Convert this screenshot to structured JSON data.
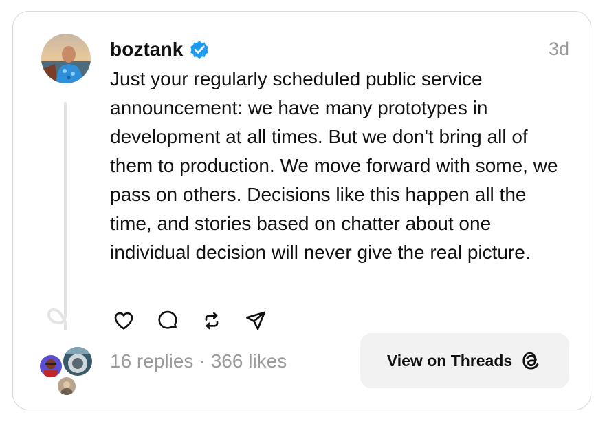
{
  "post": {
    "username": "boztank",
    "timestamp": "3d",
    "text": "Just your regularly scheduled public service announcement: we have many prototypes in development at all times. But we don't bring all of them to production. We move forward with some, we pass on others. Decisions like this happen all the time, and stories based on chatter about one individual decision will never give the real picture."
  },
  "actions": {
    "icons": [
      "heart-icon",
      "comment-icon",
      "repost-icon",
      "share-icon"
    ]
  },
  "stats": {
    "replies": "16 replies",
    "separator": "·",
    "likes": "366 likes"
  },
  "cta": {
    "label": "View on Threads",
    "icon": "threads-logo-icon"
  },
  "colors": {
    "verified": "#1d9bf0",
    "muted_text": "#9a9a9a",
    "border": "#d9d9d9",
    "button_bg": "#f2f2f2"
  }
}
